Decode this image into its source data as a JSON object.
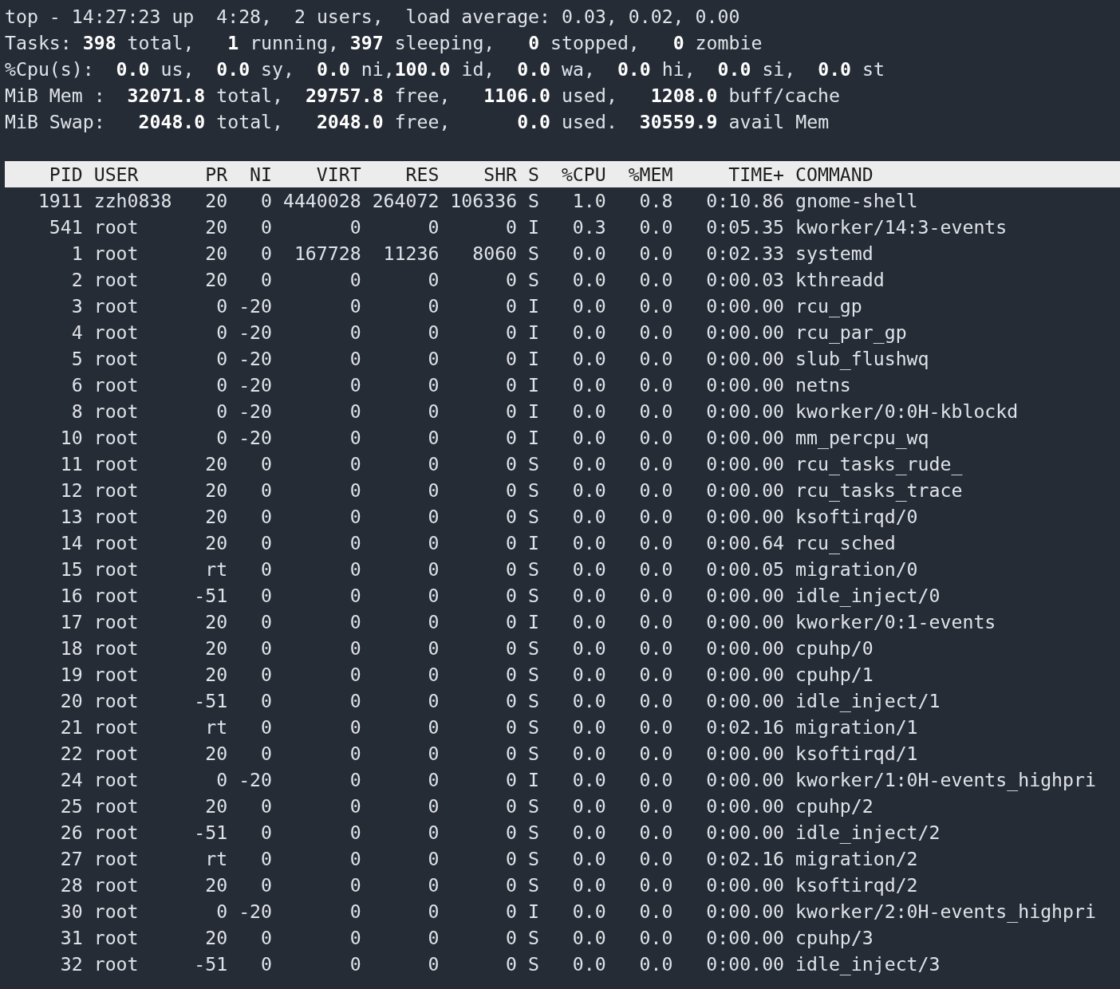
{
  "summary": [
    "top - 14:27:23 up  4:28,  2 users,  load average: 0.03, 0.02, 0.00",
    "Tasks: **398** total,   **1** running, **397** sleeping,   **0** stopped,   **0** zombie",
    "%Cpu(s):  **0.0** us,  **0.0** sy,  **0.0** ni,**100.0** id,  **0.0** wa,  **0.0** hi,  **0.0** si,  **0.0** st",
    "MiB Mem :  **32071.8** total,  **29757.8** free,   **1106.0** used,   **1208.0** buff/cache",
    "MiB Swap:   **2048.0** total,   **2048.0** free,      **0.0** used.  **30559.9** avail Mem"
  ],
  "table": {
    "columns": [
      "PID",
      "USER",
      "PR",
      "NI",
      "VIRT",
      "RES",
      "SHR",
      "S",
      "%CPU",
      "%MEM",
      "TIME+",
      "COMMAND"
    ],
    "rows": [
      {
        "cells": [
          "1911",
          "zzh0838",
          "20",
          "0",
          "4440028",
          "264072",
          "106336",
          "S",
          "1.0",
          "0.8",
          "0:10.86",
          "gnome-shell"
        ]
      },
      {
        "cells": [
          "541",
          "root",
          "20",
          "0",
          "0",
          "0",
          "0",
          "I",
          "0.3",
          "0.0",
          "0:05.35",
          "kworker/14:3-events"
        ]
      },
      {
        "cells": [
          "1",
          "root",
          "20",
          "0",
          "167728",
          "11236",
          "8060",
          "S",
          "0.0",
          "0.0",
          "0:02.33",
          "systemd"
        ]
      },
      {
        "cells": [
          "2",
          "root",
          "20",
          "0",
          "0",
          "0",
          "0",
          "S",
          "0.0",
          "0.0",
          "0:00.03",
          "kthreadd"
        ]
      },
      {
        "cells": [
          "3",
          "root",
          "0",
          "-20",
          "0",
          "0",
          "0",
          "I",
          "0.0",
          "0.0",
          "0:00.00",
          "rcu_gp"
        ]
      },
      {
        "cells": [
          "4",
          "root",
          "0",
          "-20",
          "0",
          "0",
          "0",
          "I",
          "0.0",
          "0.0",
          "0:00.00",
          "rcu_par_gp"
        ]
      },
      {
        "cells": [
          "5",
          "root",
          "0",
          "-20",
          "0",
          "0",
          "0",
          "I",
          "0.0",
          "0.0",
          "0:00.00",
          "slub_flushwq"
        ]
      },
      {
        "cells": [
          "6",
          "root",
          "0",
          "-20",
          "0",
          "0",
          "0",
          "I",
          "0.0",
          "0.0",
          "0:00.00",
          "netns"
        ]
      },
      {
        "cells": [
          "8",
          "root",
          "0",
          "-20",
          "0",
          "0",
          "0",
          "I",
          "0.0",
          "0.0",
          "0:00.00",
          "kworker/0:0H-kblockd"
        ]
      },
      {
        "cells": [
          "10",
          "root",
          "0",
          "-20",
          "0",
          "0",
          "0",
          "I",
          "0.0",
          "0.0",
          "0:00.00",
          "mm_percpu_wq"
        ]
      },
      {
        "cells": [
          "11",
          "root",
          "20",
          "0",
          "0",
          "0",
          "0",
          "S",
          "0.0",
          "0.0",
          "0:00.00",
          "rcu_tasks_rude_"
        ]
      },
      {
        "cells": [
          "12",
          "root",
          "20",
          "0",
          "0",
          "0",
          "0",
          "S",
          "0.0",
          "0.0",
          "0:00.00",
          "rcu_tasks_trace"
        ]
      },
      {
        "cells": [
          "13",
          "root",
          "20",
          "0",
          "0",
          "0",
          "0",
          "S",
          "0.0",
          "0.0",
          "0:00.00",
          "ksoftirqd/0"
        ]
      },
      {
        "cells": [
          "14",
          "root",
          "20",
          "0",
          "0",
          "0",
          "0",
          "I",
          "0.0",
          "0.0",
          "0:00.64",
          "rcu_sched"
        ]
      },
      {
        "cells": [
          "15",
          "root",
          "rt",
          "0",
          "0",
          "0",
          "0",
          "S",
          "0.0",
          "0.0",
          "0:00.05",
          "migration/0"
        ]
      },
      {
        "cells": [
          "16",
          "root",
          "-51",
          "0",
          "0",
          "0",
          "0",
          "S",
          "0.0",
          "0.0",
          "0:00.00",
          "idle_inject/0"
        ]
      },
      {
        "cells": [
          "17",
          "root",
          "20",
          "0",
          "0",
          "0",
          "0",
          "I",
          "0.0",
          "0.0",
          "0:00.00",
          "kworker/0:1-events"
        ]
      },
      {
        "cells": [
          "18",
          "root",
          "20",
          "0",
          "0",
          "0",
          "0",
          "S",
          "0.0",
          "0.0",
          "0:00.00",
          "cpuhp/0"
        ]
      },
      {
        "cells": [
          "19",
          "root",
          "20",
          "0",
          "0",
          "0",
          "0",
          "S",
          "0.0",
          "0.0",
          "0:00.00",
          "cpuhp/1"
        ]
      },
      {
        "cells": [
          "20",
          "root",
          "-51",
          "0",
          "0",
          "0",
          "0",
          "S",
          "0.0",
          "0.0",
          "0:00.00",
          "idle_inject/1"
        ]
      },
      {
        "cells": [
          "21",
          "root",
          "rt",
          "0",
          "0",
          "0",
          "0",
          "S",
          "0.0",
          "0.0",
          "0:02.16",
          "migration/1"
        ]
      },
      {
        "cells": [
          "22",
          "root",
          "20",
          "0",
          "0",
          "0",
          "0",
          "S",
          "0.0",
          "0.0",
          "0:00.00",
          "ksoftirqd/1"
        ]
      },
      {
        "cells": [
          "24",
          "root",
          "0",
          "-20",
          "0",
          "0",
          "0",
          "I",
          "0.0",
          "0.0",
          "0:00.00",
          "kworker/1:0H-events_highpri"
        ]
      },
      {
        "cells": [
          "25",
          "root",
          "20",
          "0",
          "0",
          "0",
          "0",
          "S",
          "0.0",
          "0.0",
          "0:00.00",
          "cpuhp/2"
        ]
      },
      {
        "cells": [
          "26",
          "root",
          "-51",
          "0",
          "0",
          "0",
          "0",
          "S",
          "0.0",
          "0.0",
          "0:00.00",
          "idle_inject/2"
        ]
      },
      {
        "cells": [
          "27",
          "root",
          "rt",
          "0",
          "0",
          "0",
          "0",
          "S",
          "0.0",
          "0.0",
          "0:02.16",
          "migration/2"
        ]
      },
      {
        "cells": [
          "28",
          "root",
          "20",
          "0",
          "0",
          "0",
          "0",
          "S",
          "0.0",
          "0.0",
          "0:00.00",
          "ksoftirqd/2"
        ]
      },
      {
        "cells": [
          "30",
          "root",
          "0",
          "-20",
          "0",
          "0",
          "0",
          "I",
          "0.0",
          "0.0",
          "0:00.00",
          "kworker/2:0H-events_highpri"
        ]
      },
      {
        "cells": [
          "31",
          "root",
          "20",
          "0",
          "0",
          "0",
          "0",
          "S",
          "0.0",
          "0.0",
          "0:00.00",
          "cpuhp/3"
        ]
      },
      {
        "cells": [
          "32",
          "root",
          "-51",
          "0",
          "0",
          "0",
          "0",
          "S",
          "0.0",
          "0.0",
          "0:00.00",
          "idle_inject/3"
        ]
      }
    ]
  }
}
